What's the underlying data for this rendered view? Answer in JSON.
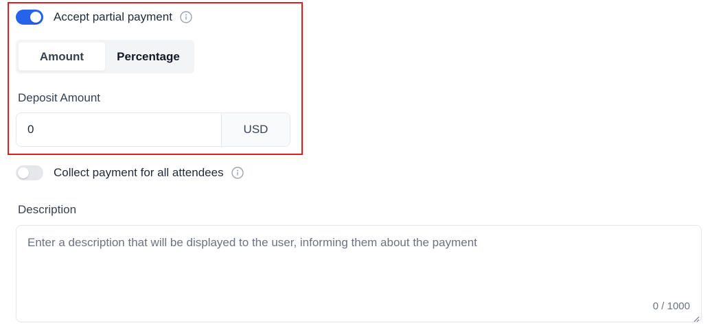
{
  "partial_payment": {
    "label": "Accept partial payment",
    "enabled": true,
    "info_icon": "info-circle-icon"
  },
  "deposit_type": {
    "options": [
      "Amount",
      "Percentage"
    ],
    "selected": "Amount"
  },
  "deposit_amount": {
    "label": "Deposit Amount",
    "value": "0",
    "currency": "USD"
  },
  "collect_all": {
    "label": "Collect payment for all attendees",
    "enabled": false,
    "info_icon": "info-circle-icon"
  },
  "description": {
    "label": "Description",
    "placeholder": "Enter a description that will be displayed to the user, informing them about the payment",
    "value": "",
    "char_count": "0 / 1000"
  },
  "colors": {
    "toggle_on": "#2563eb",
    "toggle_off": "#e5e7eb",
    "highlight": "#e01b1b"
  }
}
